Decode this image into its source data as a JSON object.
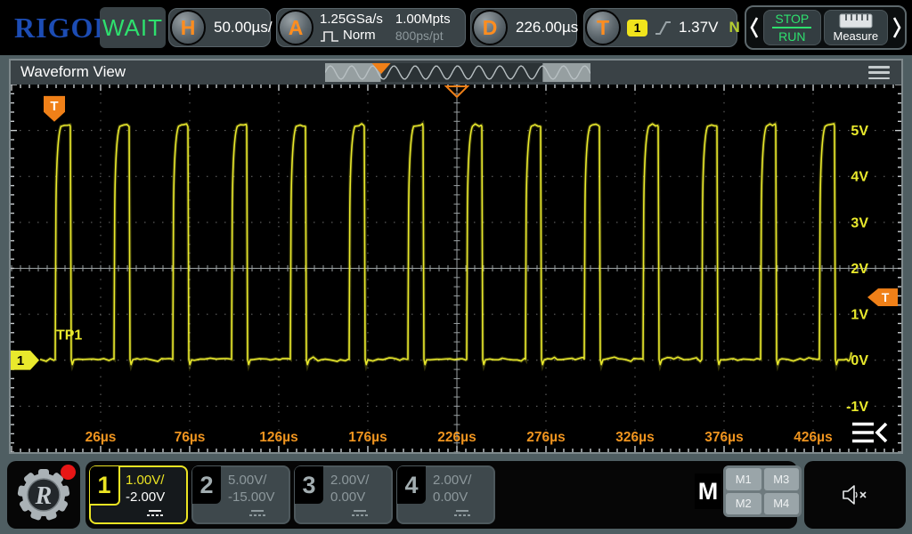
{
  "colors": {
    "brand_blue": "#1c4cb4",
    "status_green": "#2ee06e",
    "accent_orange": "#f08018",
    "label_orange": "#ef941f",
    "channel1_yellow": "#e9e92c",
    "trigger_badge_yellow": "#f0e41c",
    "normal_flag_green": "#b6cf30",
    "inactive_gray": "#8d989c",
    "grid_gray": "#6e6e6e"
  },
  "top_bar": {
    "brand": "RIGOL",
    "status": "WAIT",
    "horizontal": {
      "knob": "H",
      "timebase": "50.00µs/"
    },
    "acquisition": {
      "knob": "A",
      "sample_rate": "1.25GSa/s",
      "mode": "Norm",
      "memory_depth": "1.00Mpts",
      "time_per_point": "800ps/pt"
    },
    "delay": {
      "knob": "D",
      "value": "226.00µs"
    },
    "trigger": {
      "knob": "T",
      "source_channel": "1",
      "level": "1.37V",
      "flag": "N"
    },
    "run_control": {
      "stop": "STOP",
      "run": "RUN"
    },
    "measure_label": "Measure"
  },
  "window": {
    "title": "Waveform View"
  },
  "chart_data": {
    "type": "line",
    "title": "Waveform View",
    "x_axis": {
      "unit": "µs",
      "us_per_div": 50,
      "tick_values_us": [
        26,
        76,
        126,
        176,
        226,
        276,
        326,
        376,
        426
      ],
      "tick_labels": [
        "26µs",
        "76µs",
        "126µs",
        "176µs",
        "226µs",
        "276µs",
        "326µs",
        "376µs",
        "426µs"
      ]
    },
    "y_axis": {
      "unit": "V",
      "volts_per_div": 1,
      "tick_values_v": [
        5,
        4,
        3,
        2,
        1,
        0,
        -1
      ],
      "tick_labels": [
        "5V",
        "4V",
        "3V",
        "2V",
        "1V",
        "0V",
        "-1V"
      ]
    },
    "trigger": {
      "delay_us": 226,
      "level_v": 1.37,
      "source_channel": "1",
      "slope": "rising"
    },
    "signal": {
      "shape": "square_pulse",
      "low_v": 0.02,
      "high_v": 5.12,
      "period_us": 33,
      "pulse_width_us": 8.5,
      "first_rise_us": 0.5,
      "cycles": 14,
      "record_start_us": -8,
      "record_end_us": 448,
      "noise_v_pp": 0.06
    },
    "annotations": {
      "probe_label": "TP1",
      "probe_label_pos": {
        "t_us": 1.0,
        "v": 0.45
      },
      "channel_marker": "1",
      "channel_marker_v": 0,
      "trigger_flag_t_us": 0
    },
    "overview_strip": {
      "view_start_frac": 0.21,
      "view_end_frac": 0.82,
      "marker_frac": 0.21
    },
    "legend": "off",
    "grid": "dotted"
  },
  "bottom_bar": {
    "channels": [
      {
        "number": "1",
        "scale": "1.00V/",
        "offset": "-2.00V",
        "active": true,
        "coupling": "DC"
      },
      {
        "number": "2",
        "scale": "5.00V/",
        "offset": "-15.00V",
        "active": false,
        "coupling": "DC"
      },
      {
        "number": "3",
        "scale": "2.00V/",
        "offset": "0.00V",
        "active": false,
        "coupling": "DC"
      },
      {
        "number": "4",
        "scale": "2.00V/",
        "offset": "0.00V",
        "active": false,
        "coupling": "DC"
      }
    ],
    "math": {
      "label": "M",
      "buttons": [
        "M1",
        "M3",
        "M2",
        "M4"
      ]
    }
  },
  "icons": {
    "knob_h": "horizontal-knob-icon",
    "knob_a": "acquire-knob-icon",
    "knob_d": "delay-knob-icon",
    "knob_t": "trigger-knob-icon",
    "pulse": "pulse-shape-icon",
    "rising_slope": "rising-slope-icon",
    "ruler": "measure-ruler-icon",
    "prev": "chevron-left-icon",
    "next": "chevron-right-icon",
    "menu": "hamburger-menu-icon",
    "collapse": "plot-menu-collapse-icon",
    "gear": "rigol-gear-logo",
    "mute": "speaker-muted-icon",
    "notification": "notification-dot"
  }
}
